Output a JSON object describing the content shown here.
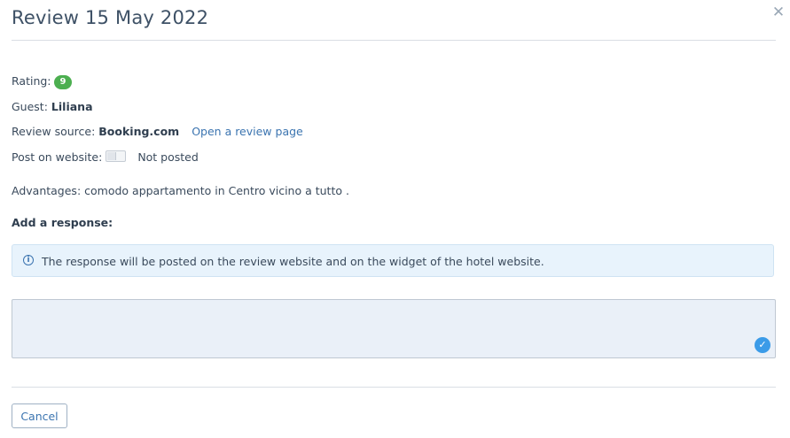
{
  "dialog": {
    "title": "Review 15 May 2022",
    "close_icon": "close-icon"
  },
  "review": {
    "rating_label": "Rating:",
    "rating_value": "9",
    "guest_label": "Guest:",
    "guest_name": "Liliana",
    "source_label": "Review source:",
    "source_name": "Booking.com",
    "open_link": "Open a review page",
    "post_label": "Post on website:",
    "post_status": "Not posted",
    "post_toggle_on": false,
    "advantages": "Advantages: comodo appartamento in Centro vicino a tutto ."
  },
  "response": {
    "heading": "Add a response:",
    "info_text": "The response will be posted on the review website and on the widget of the hotel website.",
    "info_icon": "info-icon",
    "value": "",
    "check_icon": "check-circle-icon"
  },
  "footer": {
    "cancel_label": "Cancel"
  },
  "colors": {
    "rating_badge": "#4caf50",
    "link": "#3b74b0",
    "info_bg": "#e8f3fc",
    "textarea_bg": "#eaf0f8",
    "check": "#3b9be8"
  }
}
